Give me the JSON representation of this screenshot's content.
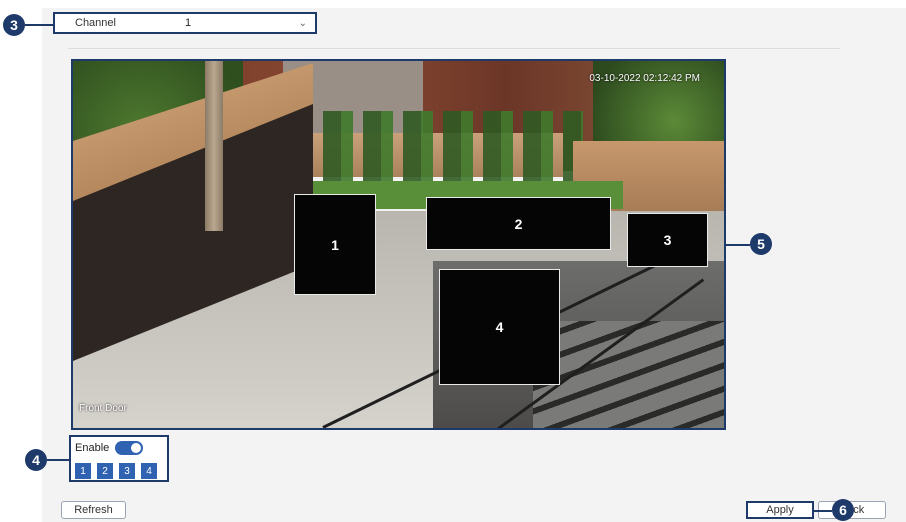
{
  "channel": {
    "label": "Channel",
    "value": "1"
  },
  "video": {
    "timestamp": "03-10-2022 02:12:42 PM",
    "camera_name": "Front Door",
    "privacy_masks": [
      "1",
      "2",
      "3",
      "4"
    ]
  },
  "enable": {
    "label": "Enable",
    "on": true
  },
  "zones": [
    "1",
    "2",
    "3",
    "4"
  ],
  "buttons": {
    "refresh": "Refresh",
    "apply": "Apply",
    "back": "Back"
  },
  "callouts": [
    "3",
    "4",
    "5",
    "6"
  ],
  "colors": {
    "accent": "#1e3a6b",
    "toggle": "#2f62b0",
    "mask": "#050505"
  }
}
